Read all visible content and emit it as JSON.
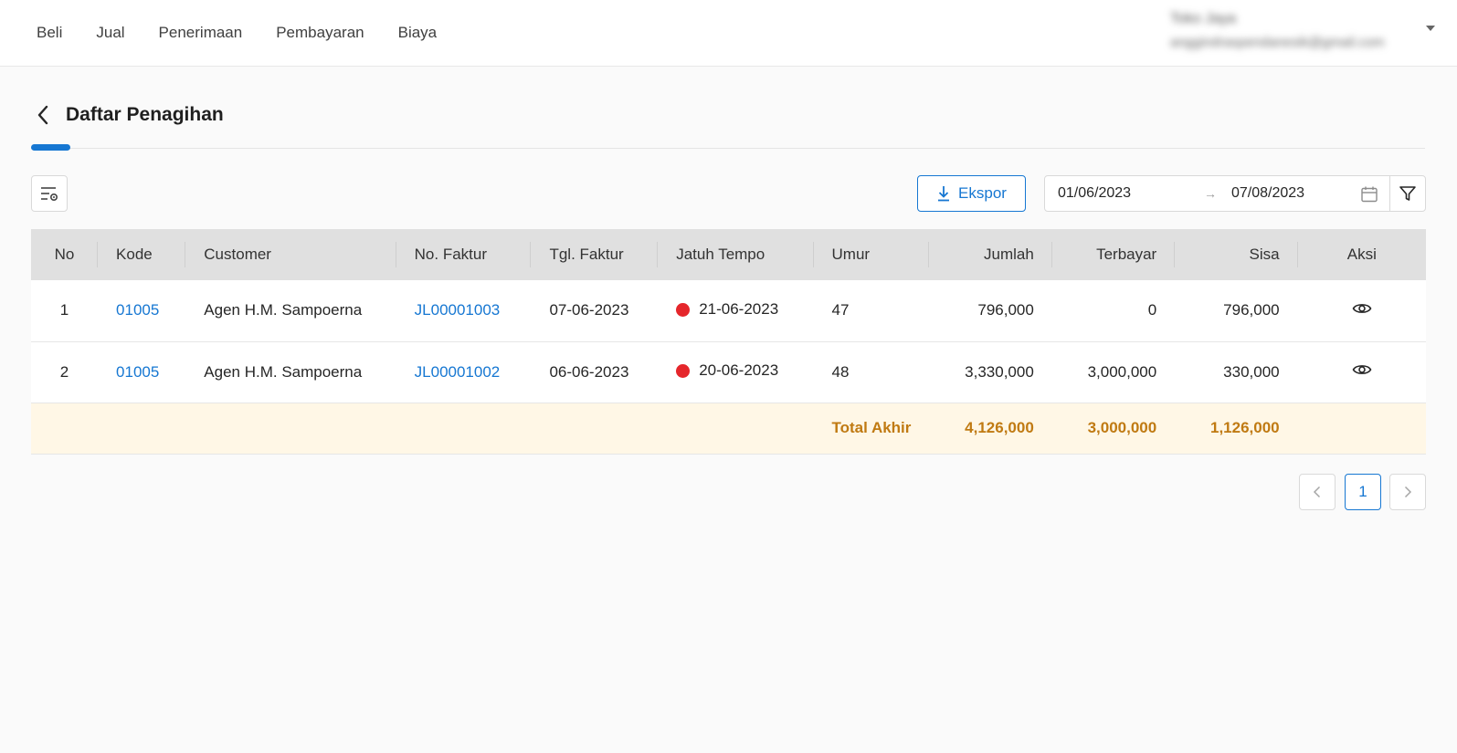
{
  "nav": {
    "items": [
      "Beli",
      "Jual",
      "Penerimaan",
      "Pembayaran",
      "Biaya"
    ]
  },
  "user": {
    "name": "Toko Jaya",
    "email": "anggindraspendanesik@gmail.com"
  },
  "page": {
    "title": "Daftar Penagihan"
  },
  "toolbar": {
    "export_label": "Ekspor",
    "date_start": "01/06/2023",
    "date_end": "07/08/2023",
    "date_arrow": "→"
  },
  "table": {
    "headers": {
      "no": "No",
      "kode": "Kode",
      "customer": "Customer",
      "no_faktur": "No. Faktur",
      "tgl_faktur": "Tgl. Faktur",
      "jatuh_tempo": "Jatuh Tempo",
      "umur": "Umur",
      "jumlah": "Jumlah",
      "terbayar": "Terbayar",
      "sisa": "Sisa",
      "aksi": "Aksi"
    },
    "rows": [
      {
        "no": "1",
        "kode": "01005",
        "customer": "Agen H.M. Sampoerna",
        "no_faktur": "JL00001003",
        "tgl_faktur": "07-06-2023",
        "jatuh_tempo": "21-06-2023",
        "umur": "47",
        "jumlah": "796,000",
        "terbayar": "0",
        "sisa": "796,000"
      },
      {
        "no": "2",
        "kode": "01005",
        "customer": "Agen H.M. Sampoerna",
        "no_faktur": "JL00001002",
        "tgl_faktur": "06-06-2023",
        "jatuh_tempo": "20-06-2023",
        "umur": "48",
        "jumlah": "3,330,000",
        "terbayar": "3,000,000",
        "sisa": "330,000"
      }
    ],
    "total": {
      "label": "Total Akhir",
      "jumlah": "4,126,000",
      "terbayar": "3,000,000",
      "sisa": "1,126,000"
    }
  },
  "pagination": {
    "current_page": "1"
  },
  "colors": {
    "accent": "#1677d2",
    "overdue_dot": "#e5262b",
    "total_text": "#c07a12",
    "total_bg": "#fff7e6",
    "header_bg": "#e0e0e0"
  },
  "icons": {
    "back": "chevron-left-icon",
    "settings": "column-settings-icon",
    "export": "download-icon",
    "calendar": "calendar-icon",
    "filter": "filter-icon",
    "view": "eye-icon",
    "prev": "chevron-left-icon",
    "next": "chevron-right-icon",
    "user_menu": "caret-down-icon"
  }
}
